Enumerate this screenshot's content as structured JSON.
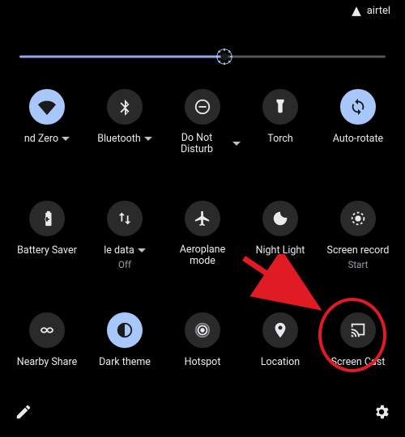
{
  "status": {
    "carrier": "airtel"
  },
  "brightness": {
    "percent": 56
  },
  "tiles": [
    {
      "id": "wifi",
      "label": "nd Zero",
      "sublabel": "",
      "dropdown": true,
      "active": true
    },
    {
      "id": "bluetooth",
      "label": "Bluetooth",
      "sublabel": "",
      "dropdown": true,
      "active": false
    },
    {
      "id": "dnd",
      "label": "Do Not Disturb",
      "sublabel": "",
      "dropdown": true,
      "active": false
    },
    {
      "id": "torch",
      "label": "Torch",
      "sublabel": "",
      "dropdown": false,
      "active": false
    },
    {
      "id": "autorotate",
      "label": "Auto-rotate",
      "sublabel": "",
      "dropdown": false,
      "active": true
    },
    {
      "id": "battery-saver",
      "label": "Battery Saver",
      "sublabel": "",
      "dropdown": false,
      "active": false
    },
    {
      "id": "mobile-data",
      "label": "le data",
      "sublabel": "Off",
      "dropdown": true,
      "active": false
    },
    {
      "id": "aeroplane",
      "label": "Aeroplane mode",
      "sublabel": "",
      "dropdown": false,
      "active": false
    },
    {
      "id": "night-light",
      "label": "Night Light",
      "sublabel": "",
      "dropdown": false,
      "active": false
    },
    {
      "id": "screen-record",
      "label": "Screen record",
      "sublabel": "Start",
      "dropdown": false,
      "active": false
    },
    {
      "id": "nearby-share",
      "label": "Nearby Share",
      "sublabel": "",
      "dropdown": false,
      "active": false
    },
    {
      "id": "dark-theme",
      "label": "Dark theme",
      "sublabel": "",
      "dropdown": false,
      "active": true
    },
    {
      "id": "hotspot",
      "label": "Hotspot",
      "sublabel": "",
      "dropdown": false,
      "active": false
    },
    {
      "id": "location",
      "label": "Location",
      "sublabel": "",
      "dropdown": false,
      "active": false
    },
    {
      "id": "screen-cast",
      "label": "Screen Cast",
      "sublabel": "",
      "dropdown": false,
      "active": false
    }
  ],
  "annotation": {
    "target_tile": "screen-cast"
  }
}
